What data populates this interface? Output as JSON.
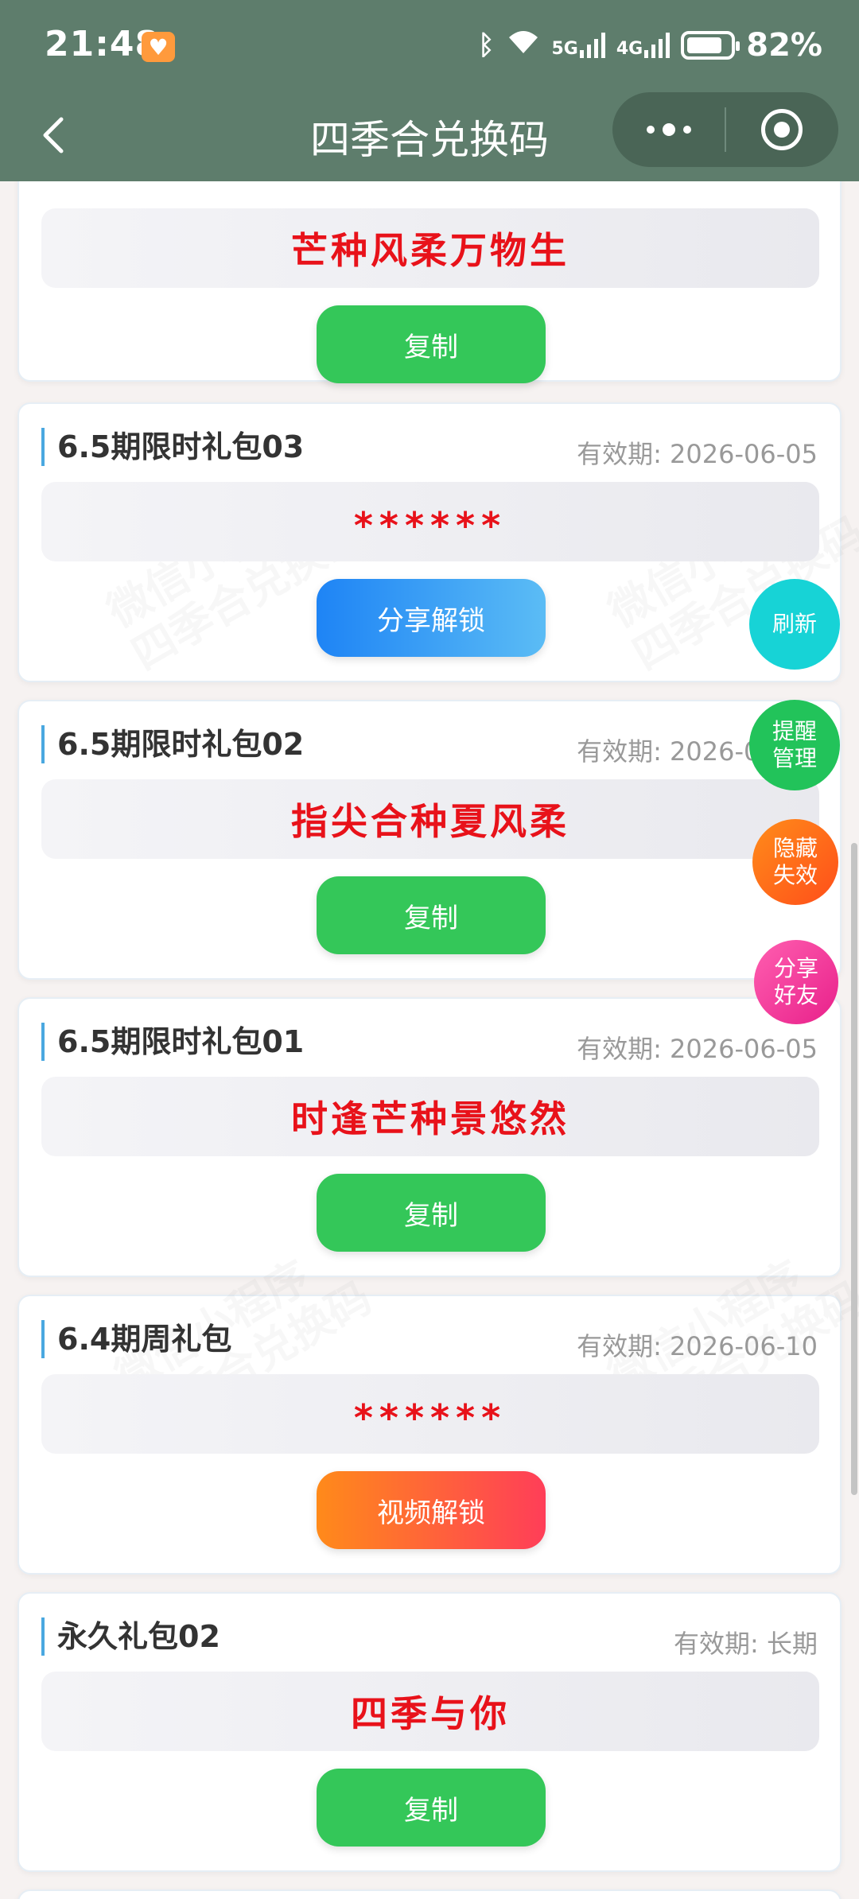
{
  "status_bar": {
    "time": "21:48",
    "network_5g": "5G",
    "network_4g": "4G",
    "battery": "82%",
    "battery_level": 0.82
  },
  "nav": {
    "title": "四季合兑换码"
  },
  "cards": [
    {
      "code": "芒种风柔万物生",
      "button": "复制"
    },
    {
      "name": "6.5期限时礼包03",
      "expiry": "有效期: 2026-06-05",
      "code": "******",
      "button": "分享解锁"
    },
    {
      "name": "6.5期限时礼包02",
      "expiry": "有效期: 2026-06-05",
      "code": "指尖合种夏风柔",
      "button": "复制"
    },
    {
      "name": "6.5期限时礼包01",
      "expiry": "有效期: 2026-06-05",
      "code": "时逢芒种景悠然",
      "button": "复制"
    },
    {
      "name": "6.4期周礼包",
      "expiry": "有效期: 2026-06-10",
      "code": "******",
      "button": "视频解锁"
    },
    {
      "name": "永久礼包02",
      "expiry": "有效期: 长期",
      "code": "四季与你",
      "button": "复制"
    }
  ],
  "watermark": {
    "line1": "微信小程序",
    "line2": "四季合兑换码"
  },
  "floating": {
    "refresh": "刷新",
    "remind_1": "提醒",
    "remind_2": "管理",
    "hide_1": "隐藏",
    "hide_2": "失效",
    "share_1": "分享",
    "share_2": "好友"
  },
  "colors": {
    "header": "#5e7d6c",
    "code_text": "#e8121a",
    "copy_button": "#34c759",
    "refresh": "#17d3d6",
    "remind": "#22c35a",
    "hide": "#ff5a1f",
    "share": "#f03ca0"
  }
}
